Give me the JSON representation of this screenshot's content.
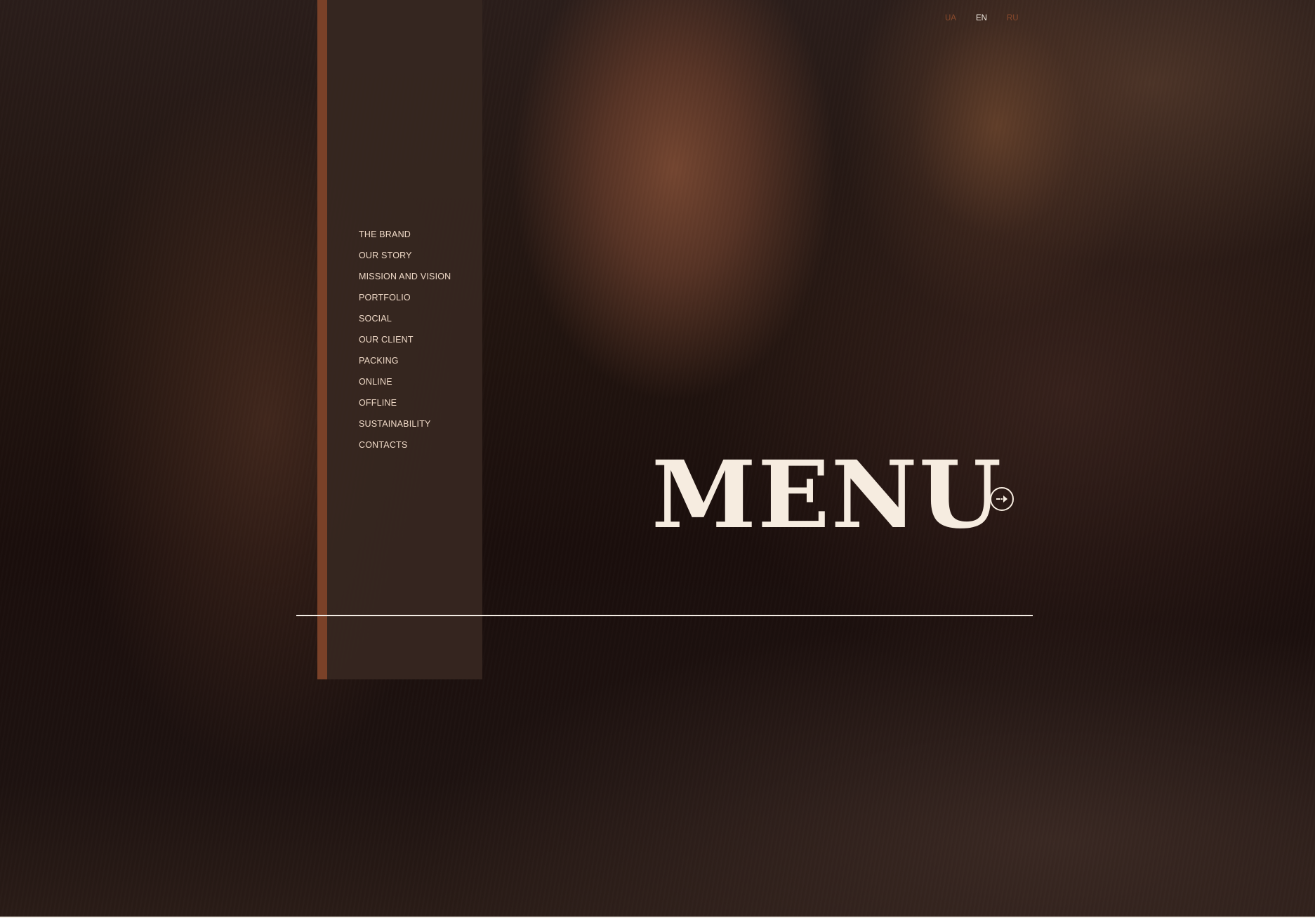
{
  "language_switcher": {
    "items": [
      "UA",
      "EN",
      "RU"
    ],
    "active": "EN",
    "colors": {
      "active": "#f3ece4",
      "inactive": "#8a4a2c"
    }
  },
  "sidebar": {
    "accent_color": "#7a4128",
    "items": [
      {
        "label": "THE BRAND"
      },
      {
        "label": "OUR STORY"
      },
      {
        "label": "MISSION AND VISION"
      },
      {
        "label": "PORTFOLIO"
      },
      {
        "label": "SOCIAL"
      },
      {
        "label": "OUR CLIENT"
      },
      {
        "label": "PACKING"
      },
      {
        "label": "ONLINE"
      },
      {
        "label": "OFFLINE"
      },
      {
        "label": "SUSTAINABILITY"
      },
      {
        "label": "CONTACTS"
      }
    ]
  },
  "hero": {
    "title": "MENU",
    "toggle_icon": "arrow-right-circle-icon",
    "background": "photo-portrait-woman"
  }
}
